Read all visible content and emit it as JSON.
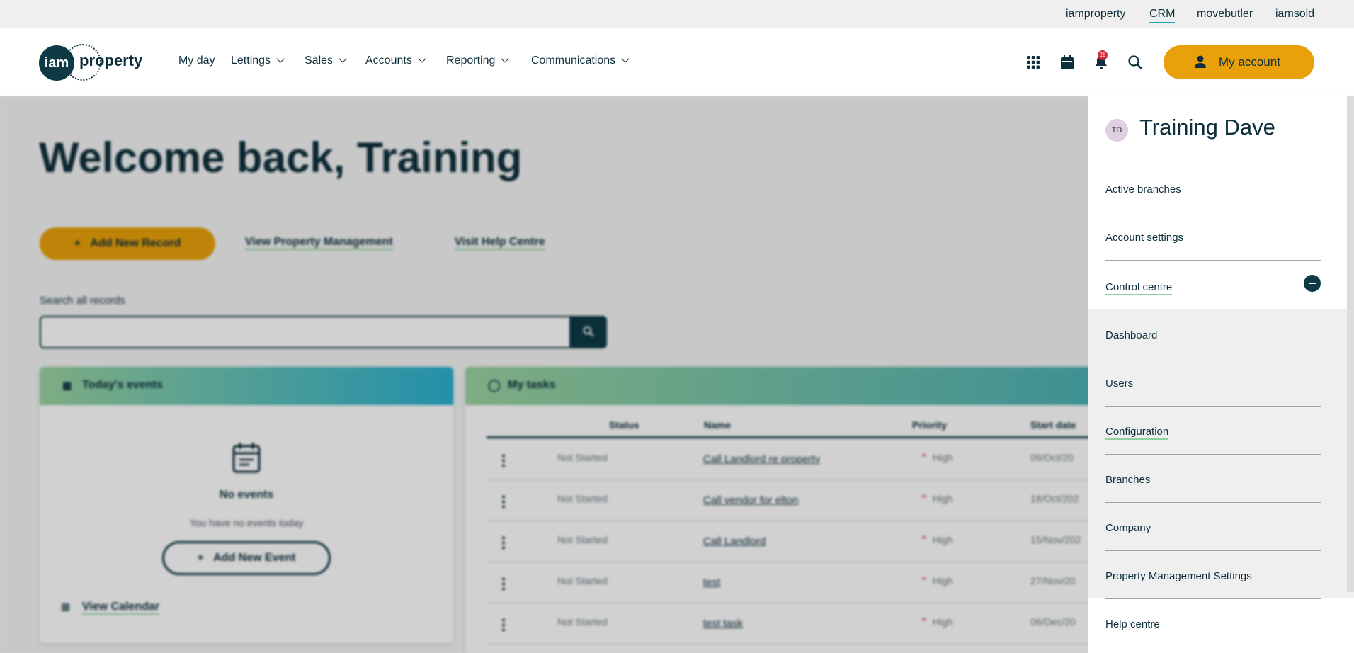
{
  "topbar": {
    "links": [
      "iamproperty",
      "CRM",
      "movebutler",
      "iamsold"
    ]
  },
  "logo": {
    "mark": "iam",
    "word": "property"
  },
  "nav": {
    "items": [
      "My day",
      "Lettings",
      "Sales",
      "Accounts",
      "Reporting",
      "Communications"
    ]
  },
  "header": {
    "notifications_count": "26",
    "my_account_label": "My account",
    "icons": [
      "grid-icon",
      "calendar-icon",
      "bell-icon",
      "search-icon"
    ]
  },
  "main": {
    "welcome": "Welcome back, Training",
    "add_record_label": "Add New Record",
    "view_pm_label": "View Property Management",
    "help_label": "Visit Help Centre",
    "search_label": "Search all records",
    "search_placeholder": ""
  },
  "events": {
    "title": "Today's events",
    "empty_title": "No events",
    "empty_text": "You have no events today",
    "add_event_label": "Add New Event",
    "view_calendar_label": "View Calendar"
  },
  "tasks": {
    "title": "My tasks",
    "columns": [
      "Status",
      "Name",
      "Priority",
      "Start date"
    ],
    "rows": [
      {
        "status": "Not Started",
        "name": "Call Landlord re property",
        "priority": "High",
        "date": "09/Oct/20"
      },
      {
        "status": "Not Started",
        "name": "Call vendor for elton",
        "priority": "High",
        "date": "18/Oct/202"
      },
      {
        "status": "Not Started",
        "name": "Call Landlord",
        "priority": "High",
        "date": "15/Nov/202"
      },
      {
        "status": "Not Started",
        "name": "test",
        "priority": "High",
        "date": "27/Nov/20"
      },
      {
        "status": "Not Started",
        "name": "test task",
        "priority": "High",
        "date": "06/Dec/20"
      }
    ]
  },
  "panel": {
    "initials": "TD",
    "user_name": "Training Dave",
    "items": [
      "Active branches",
      "Account settings",
      "Control centre"
    ],
    "sub_items": [
      "Dashboard",
      "Users",
      "Configuration",
      "Branches",
      "Company",
      "Property Management Settings"
    ],
    "footer_item": "Help centre"
  },
  "colors": {
    "accent": "#e8a10b",
    "brand": "#0e3a45",
    "underline": "#8fd0a0"
  }
}
